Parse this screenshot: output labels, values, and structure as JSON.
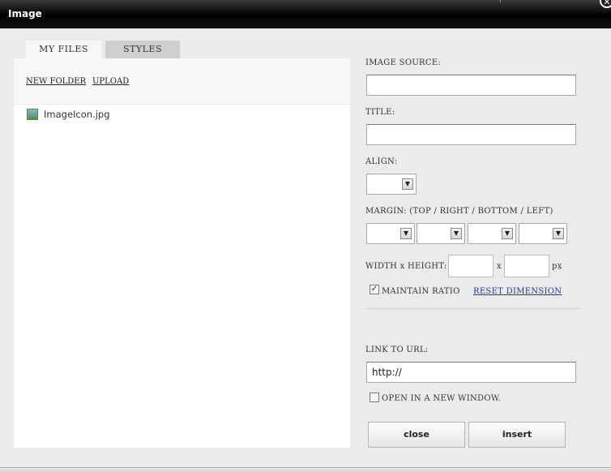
{
  "window": {
    "title": "Image"
  },
  "tabs": [
    {
      "label": "MY FILES",
      "active": true
    },
    {
      "label": "STYLES",
      "active": false
    }
  ],
  "files": {
    "actions": {
      "new_folder": "NEW FOLDER",
      "upload": "UPLOAD"
    },
    "items": [
      {
        "name": "ImageIcon.jpg",
        "icon": "image-file-icon"
      }
    ]
  },
  "form": {
    "image_source": {
      "label": "IMAGE SOURCE:",
      "value": ""
    },
    "title": {
      "label": "TITLE:",
      "value": ""
    },
    "align": {
      "label": "ALIGN:",
      "value": ""
    },
    "margin": {
      "label": "MARGIN: (TOP / RIGHT / BOTTOM / LEFT)"
    },
    "size": {
      "label": "WIDTH x HEIGHT:",
      "separator": "x",
      "unit": "px"
    },
    "maintain_ratio": {
      "label": "MAINTAIN RATIO",
      "checked": true
    },
    "reset_dimension": "RESET DIMENSION",
    "link_url": {
      "label": "LINK TO URL:",
      "value": "http://"
    },
    "new_window": {
      "label": "OPEN IN A NEW WINDOW.",
      "checked": false
    }
  },
  "buttons": {
    "close": "close",
    "insert": "insert"
  }
}
